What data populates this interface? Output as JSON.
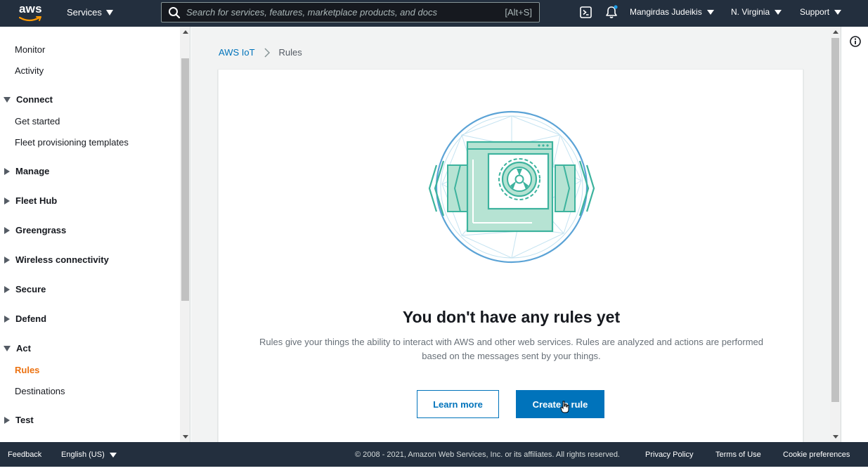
{
  "topnav": {
    "logo_text": "aws",
    "services_label": "Services",
    "search": {
      "placeholder": "Search for services, features, marketplace products, and docs",
      "shortcut": "[Alt+S]"
    },
    "icons": [
      "cloudshell-icon",
      "bell-icon"
    ],
    "user_label": "Mangirdas Judeikis",
    "region_label": "N. Virginia",
    "support_label": "Support"
  },
  "sidebar": {
    "items": [
      {
        "label": "Monitor",
        "type": "link"
      },
      {
        "label": "Activity",
        "type": "link"
      },
      {
        "label": "Connect",
        "type": "section",
        "expanded": true
      },
      {
        "label": "Get started",
        "type": "link"
      },
      {
        "label": "Fleet provisioning templates",
        "type": "link"
      },
      {
        "label": "Manage",
        "type": "section",
        "expanded": false
      },
      {
        "label": "Fleet Hub",
        "type": "section",
        "expanded": false
      },
      {
        "label": "Greengrass",
        "type": "section",
        "expanded": false
      },
      {
        "label": "Wireless connectivity",
        "type": "section",
        "expanded": false
      },
      {
        "label": "Secure",
        "type": "section",
        "expanded": false
      },
      {
        "label": "Defend",
        "type": "section",
        "expanded": false
      },
      {
        "label": "Act",
        "type": "section",
        "expanded": true
      },
      {
        "label": "Rules",
        "type": "link",
        "active": true
      },
      {
        "label": "Destinations",
        "type": "link"
      },
      {
        "label": "Test",
        "type": "section",
        "expanded": false
      }
    ]
  },
  "breadcrumb": {
    "root": "AWS IoT",
    "current": "Rules"
  },
  "empty_state": {
    "title": "You don't have any rules yet",
    "description": "Rules give your things the ability to interact with AWS and other web services. Rules are analyzed and actions are performed based on the messages sent by your things.",
    "learn_more_label": "Learn more",
    "create_label": "Create a rule"
  },
  "footer": {
    "feedback_label": "Feedback",
    "language_label": "English (US)",
    "copyright": "© 2008 - 2021, Amazon Web Services, Inc. or its affiliates. All rights reserved.",
    "privacy_label": "Privacy Policy",
    "terms_label": "Terms of Use",
    "cookie_label": "Cookie preferences"
  },
  "colors": {
    "nav_bg": "#232f3e",
    "link_blue": "#0073bb",
    "active_orange": "#ec7211",
    "illustration_green": "#3db39e",
    "illustration_blue": "#5ba3d6"
  }
}
